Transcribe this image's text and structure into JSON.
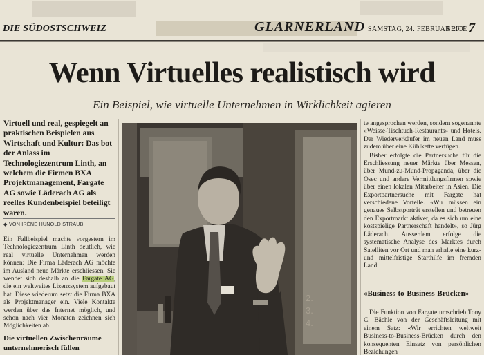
{
  "masthead": {
    "paper_name": "DIE SÜDOSTSCHWEIZ",
    "section": "GLARNERLAND",
    "date": "SAMSTAG, 24. FEBRUAR 2001",
    "page_label": "SEITE",
    "page_number": "7"
  },
  "article": {
    "headline": "Wenn Virtuelles realistisch wird",
    "subheadline": "Ein Beispiel, wie virtuelle Unternehmen in Wirklichkeit agieren",
    "lead": "Virtuell und real, gespiegelt an praktischen Beispielen aus Wirtschaft und Kultur: Das bot der Anlass im Technologiezentrum Linth, an welchem die Firmen BXA Projektmanagement, Fargate AG sowie Läderach AG als reelles Kundenbeispiel beteiligt waren.",
    "byline": "VON IRÈNE HUNOLD STRAUB",
    "body_left_1": "Ein Fallbeispiel machte vorgestern im Technologiezentrum Linth deutlich, wie real virtuelle Unternehmen werden können: Die Firma Läderach AG möchte im Ausland neue Märkte erschliessen. Sie wendet sich deshalb an die ",
    "body_left_highlight": "Fargate AG",
    "body_left_2": ", die ein weltweites Lizenzsystem aufgebaut hat. Diese wiederum setzt die Firma BXA als Projektmanager ein. Viele Kontakte werden über das Internet möglich, und schon nach vier Monaten zeichnen sich Möglichkeiten ab.",
    "subheading_left": "Die virtuellen Zwischenräume unternehmerisch füllen",
    "body_right_1": "te angesprochen werden, sondern sogenannte «Weisse-Tischtuch-Restaurants» und Hotels. Der Wiederverkäufer im neuen Land muss zudem über eine Kühlkette verfügen.",
    "body_right_2": "Bisher erfolgte die Partnersuche für die Erschliessung neuer Märkte über Messen, über Mund-zu-Mund-Propaganda, über die Osec und andere Vermittlungsfirmen sowie über einen lokalen Mitarbeiter in Asien. Die Exportpartnersuche mit Fargate hat verschiedene Vorteile. «Wir müssen ein genaues Selbstporträt erstellen und betreuen den Exportmarkt aktiver, da es sich um eine kostspielige Partnerschaft handelt», so Jürg Läderach. Ausserdem erfolge die systematische Analyse des Marktes durch Satelliten vor Ort und man erhalte eine kurz- und mittelfristige Starthilfe im fremden Land.",
    "subheading_right": "«Business-to-Business-Brücken»",
    "body_right_3": "Die Funktion von Fargate umschrieb Tony C. Bächle von der Geschäftsleitung mit einem Satz: «Wir errichten weltweit Business-to-Business-Brücken durch den konsequenten Einsatz von persönlichen Beziehungen"
  },
  "photo": {
    "description_icon": "photo-speaker",
    "bg_color": "#3a3530"
  },
  "colors": {
    "paper": "#e9e4d6",
    "highlight": "#b9cf7c",
    "ink": "#1c1a16"
  }
}
